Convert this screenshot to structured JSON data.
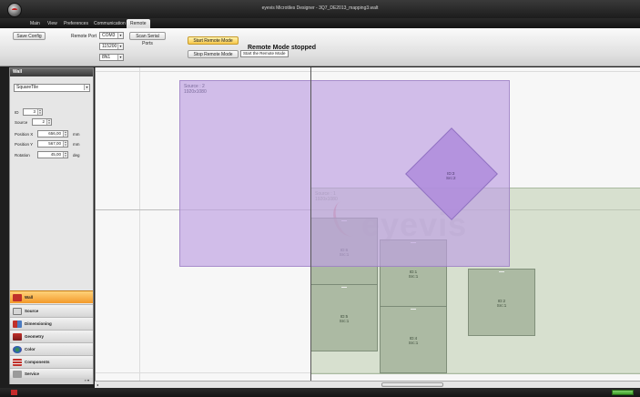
{
  "window": {
    "title": "eyevis Microtiles Designer - 3Q7_DE2013_mapping3.walt"
  },
  "menu": {
    "items": [
      "Main",
      "View",
      "Preferences",
      "Communication",
      "Remote"
    ],
    "active": "Remote"
  },
  "ribbon": {
    "save_config": "Save Config",
    "remote_port_label": "Remote Port",
    "port_value": "COM3",
    "baud_value": "115200",
    "parity_value": "8N1",
    "scan_ports": "Scan Serial Ports",
    "start_remote": "Start Remote Mode",
    "stop_remote": "Stop Remote Mode",
    "remote_status": "Remote Mode stopped",
    "tooltip": "Start the Remote Mode"
  },
  "left_panel": {
    "header": "Wall",
    "tile_type": "SquareTile",
    "id_label": "ID",
    "id_value": "3",
    "source_label": "Source",
    "source_value": "2",
    "pos_x_label": "Position X",
    "pos_x_value": "656,00",
    "pos_y_label": "Position Y",
    "pos_y_value": "567,00",
    "rotation_label": "Rotation",
    "rotation_value": "45,00",
    "unit_mm": "mm",
    "unit_deg": "deg",
    "nav": [
      "Wall",
      "Source",
      "Dimensioning",
      "Geometry",
      "Color",
      "Components",
      "Service"
    ],
    "nav_active": "Wall"
  },
  "canvas": {
    "source2_label": "Source : 2",
    "source2_res": "1920x1080",
    "source1_label": "Source : 1",
    "source1_res": "1920x1080",
    "watermark": "eyevis",
    "tiles": [
      {
        "id": "ID:6",
        "src": "Src:1"
      },
      {
        "id": "ID:1",
        "src": "Src:1"
      },
      {
        "id": "ID:2",
        "src": "Src:1"
      },
      {
        "id": "ID:5",
        "src": "Src:1"
      },
      {
        "id": "ID:4",
        "src": "Src:1"
      }
    ],
    "diamond": {
      "id": "ID:3",
      "src": "Src:2"
    }
  },
  "colors": {
    "accent": "#f39a2a",
    "source2": "#bea0e1",
    "source1": "#becdaf"
  }
}
